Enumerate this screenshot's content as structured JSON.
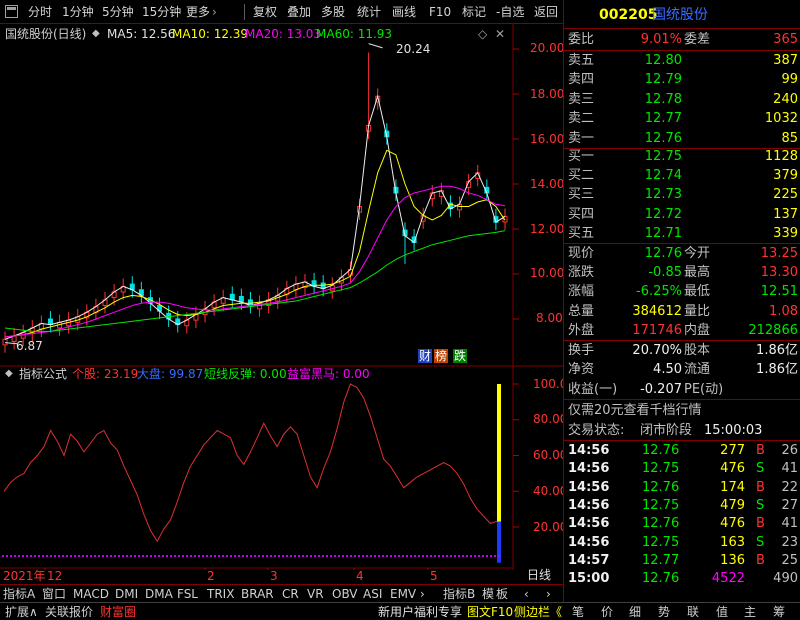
{
  "toolbar": {
    "period_tabs": [
      "分时",
      "1分钟",
      "5分钟",
      "15分钟",
      "更多"
    ],
    "more_arrow": "›",
    "actions": [
      "复权",
      "叠加",
      "多股",
      "统计",
      "画线",
      "F10",
      "标记",
      "-自选",
      "返回"
    ]
  },
  "kline": {
    "stock_label": "国统股份(日线)",
    "ma5": "MA5: 12.56",
    "ma10": "MA10: 12.39",
    "ma20": "MA20: 13.03",
    "ma60": "MA60: 11.93",
    "high_label": "20.24",
    "low_label": "6.87",
    "badges": [
      "财",
      "榜",
      "跌"
    ]
  },
  "indicator": {
    "name": "指标公式",
    "gegu": "个股: 23.19",
    "dapan": "大盘: 99.87",
    "duanxian": "短线反弹: 0.00",
    "yifu": "益富黑马: 0.00"
  },
  "axis": {
    "kline": [
      "20.00",
      "18.00",
      "16.00",
      "14.00",
      "12.00",
      "10.00",
      "8.00"
    ],
    "indicator": [
      "100.0",
      "80.00",
      "60.00",
      "40.00",
      "20.00"
    ],
    "dates": [
      "2021年",
      "12",
      "2",
      "3",
      "4",
      "5"
    ]
  },
  "chart_data": [
    {
      "type": "candlestick",
      "title": "国统股份(日线)",
      "ylim": [
        6.5,
        21
      ],
      "series": [
        {
          "name": "MA5",
          "values": [
            7.1,
            7.25,
            7.4,
            7.6,
            7.8,
            7.75,
            7.85,
            7.95,
            8.1,
            8.3,
            8.55,
            8.85,
            9.2,
            9.45,
            9.3,
            9.05,
            8.7,
            8.35,
            8.0,
            7.75,
            7.95,
            8.2,
            8.45,
            8.75,
            8.95,
            8.85,
            8.75,
            8.6,
            8.7,
            8.85,
            9.05,
            9.35,
            9.55,
            9.65,
            9.45,
            9.35,
            9.5,
            9.85,
            10.2,
            13.0,
            16.6,
            17.9,
            16.1,
            13.6,
            11.7,
            11.4,
            12.6,
            13.6,
            13.7,
            12.9,
            13.1,
            14.1,
            14.5,
            13.6,
            12.3,
            12.56
          ]
        },
        {
          "name": "MA10",
          "values": [
            7.2,
            7.25,
            7.3,
            7.4,
            7.55,
            7.65,
            7.75,
            7.85,
            7.95,
            8.1,
            8.3,
            8.5,
            8.75,
            8.95,
            9.05,
            9.0,
            8.85,
            8.65,
            8.4,
            8.2,
            8.15,
            8.2,
            8.3,
            8.45,
            8.6,
            8.65,
            8.7,
            8.7,
            8.75,
            8.8,
            8.95,
            9.1,
            9.3,
            9.45,
            9.5,
            9.5,
            9.55,
            9.7,
            9.9,
            11.0,
            12.8,
            14.5,
            15.5,
            15.3,
            14.0,
            13.0,
            12.6,
            12.4,
            12.6,
            13.1,
            13.0,
            13.0,
            13.2,
            13.3,
            13.0,
            12.39
          ]
        },
        {
          "name": "MA20",
          "values": [
            7.2,
            7.25,
            7.3,
            7.35,
            7.4,
            7.45,
            7.55,
            7.65,
            7.75,
            7.85,
            8.0,
            8.15,
            8.3,
            8.45,
            8.6,
            8.7,
            8.75,
            8.75,
            8.7,
            8.6,
            8.5,
            8.45,
            8.4,
            8.4,
            8.45,
            8.5,
            8.55,
            8.6,
            8.65,
            8.7,
            8.75,
            8.85,
            8.95,
            9.05,
            9.15,
            9.25,
            9.35,
            9.45,
            9.6,
            10.1,
            10.8,
            11.6,
            12.4,
            13.0,
            13.4,
            13.6,
            13.7,
            13.8,
            13.9,
            13.9,
            13.8,
            13.6,
            13.5,
            13.3,
            13.1,
            13.03
          ]
        },
        {
          "name": "MA60",
          "values": [
            7.6,
            7.55,
            7.5,
            7.45,
            7.45,
            7.45,
            7.5,
            7.55,
            7.6,
            7.65,
            7.7,
            7.75,
            7.8,
            7.85,
            7.9,
            7.95,
            8.0,
            8.05,
            8.1,
            8.15,
            8.2,
            8.25,
            8.3,
            8.35,
            8.4,
            8.45,
            8.5,
            8.55,
            8.6,
            8.65,
            8.7,
            8.75,
            8.8,
            8.9,
            9.0,
            9.1,
            9.2,
            9.3,
            9.4,
            9.6,
            9.85,
            10.1,
            10.4,
            10.65,
            10.85,
            11.0,
            11.15,
            11.3,
            11.4,
            11.5,
            11.6,
            11.7,
            11.75,
            11.8,
            11.85,
            11.93
          ]
        }
      ]
    },
    {
      "type": "line",
      "title": "指标公式",
      "ylim": [
        0,
        100
      ],
      "series": [
        {
          "name": "个股",
          "values": [
            40,
            45,
            48,
            50,
            56,
            60,
            65,
            74,
            68,
            60,
            72,
            68,
            62,
            67,
            72,
            74,
            67,
            63,
            54,
            46,
            38,
            27,
            18,
            12,
            19,
            24,
            34,
            45,
            54,
            60,
            66,
            70,
            74,
            72,
            70,
            60,
            55,
            62,
            70,
            78,
            71,
            65,
            72,
            76,
            72,
            60,
            48,
            42,
            53,
            62,
            75,
            90,
            100,
            98,
            92,
            82,
            70,
            58,
            54,
            48,
            42,
            45,
            48,
            50,
            52,
            54,
            56,
            54,
            50,
            44,
            36,
            30,
            26,
            22,
            23.19
          ]
        }
      ]
    }
  ],
  "quote": {
    "code": "002205",
    "name": "国统股份",
    "weibi_label": "委比",
    "weibi_value": "9.01%",
    "weicha_label": "委差",
    "weicha_value": "365",
    "asks": [
      {
        "label": "卖五",
        "price": "12.80",
        "vol": "387"
      },
      {
        "label": "卖四",
        "price": "12.79",
        "vol": "99"
      },
      {
        "label": "卖三",
        "price": "12.78",
        "vol": "240"
      },
      {
        "label": "卖二",
        "price": "12.77",
        "vol": "1032"
      },
      {
        "label": "卖一",
        "price": "12.76",
        "vol": "85"
      }
    ],
    "bids": [
      {
        "label": "买一",
        "price": "12.75",
        "vol": "1128"
      },
      {
        "label": "买二",
        "price": "12.74",
        "vol": "379"
      },
      {
        "label": "买三",
        "price": "12.73",
        "vol": "225"
      },
      {
        "label": "买四",
        "price": "12.72",
        "vol": "137"
      },
      {
        "label": "买五",
        "price": "12.71",
        "vol": "339"
      }
    ],
    "stats": [
      {
        "l1": "现价",
        "v1": "12.76",
        "l2": "今开",
        "v2": "13.25"
      },
      {
        "l1": "涨跌",
        "v1": "-0.85",
        "l2": "最高",
        "v2": "13.30"
      },
      {
        "l1": "涨幅",
        "v1": "-6.25%",
        "l2": "最低",
        "v2": "12.51"
      },
      {
        "l1": "总量",
        "v1": "384612",
        "l2": "量比",
        "v2": "1.08"
      },
      {
        "l1": "外盘",
        "v1": "171746",
        "l2": "内盘",
        "v2": "212866"
      }
    ],
    "stats2": [
      {
        "l1": "换手",
        "v1": "20.70%",
        "l2": "股本",
        "v2": "1.86亿"
      },
      {
        "l1": "净资",
        "v1": "4.50",
        "l2": "流通",
        "v2": "1.86亿"
      },
      {
        "l1": "收益(一)",
        "v1": "-0.207",
        "l2": "PE(动)",
        "v2": ""
      }
    ],
    "promo": "仅需20元查看千档行情",
    "status_label": "交易状态:",
    "status_value": "闭市阶段",
    "status_time": "15:00:03"
  },
  "ticks": [
    {
      "time": "14:56",
      "price": "12.76",
      "vol": "277",
      "side": "B",
      "count": "26"
    },
    {
      "time": "14:56",
      "price": "12.75",
      "vol": "476",
      "side": "S",
      "count": "41"
    },
    {
      "time": "14:56",
      "price": "12.76",
      "vol": "174",
      "side": "B",
      "count": "22"
    },
    {
      "time": "14:56",
      "price": "12.75",
      "vol": "479",
      "side": "S",
      "count": "27"
    },
    {
      "time": "14:56",
      "price": "12.76",
      "vol": "476",
      "side": "B",
      "count": "41"
    },
    {
      "time": "14:56",
      "price": "12.75",
      "vol": "163",
      "side": "S",
      "count": "23"
    },
    {
      "time": "14:57",
      "price": "12.77",
      "vol": "136",
      "side": "B",
      "count": "25"
    },
    {
      "time": "15:00",
      "price": "12.76",
      "vol": "4522",
      "side": "",
      "count": "490"
    }
  ],
  "bottom": {
    "indicator_tabs": [
      "指标A",
      "窗口",
      "MACD",
      "DMI",
      "DMA",
      "FSL",
      "TRIX",
      "BRAR",
      "CR",
      "VR",
      "OBV",
      "ASI",
      "EMV",
      "›",
      "指标B",
      "模",
      "板",
      "‹",
      "›"
    ],
    "period": "日线",
    "left_tabs": [
      "扩展∧",
      "关联报价",
      "财富圈"
    ],
    "promo": "新用户福利专享",
    "right_tabs": [
      "图文F10",
      "侧边栏《"
    ],
    "side_tabs": [
      "笔",
      "价",
      "细",
      "势",
      "联",
      "值",
      "主",
      "筹"
    ]
  }
}
